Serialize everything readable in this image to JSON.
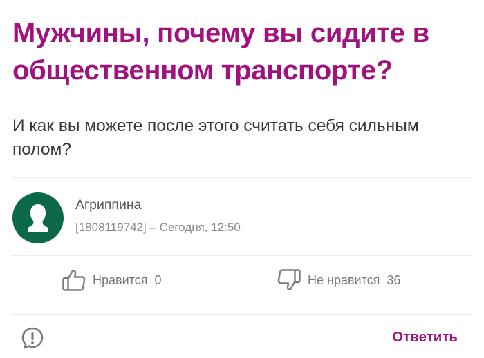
{
  "question": {
    "title": "Мужчины, почему вы сидите в общественном транспорте?",
    "body": "И как вы можете после этого считать себя сильным полом?"
  },
  "author": {
    "name": "Агриппина",
    "info": "[1808119742] – Сегодня, 12:50",
    "avatar_icon": "person-silhouette-icon",
    "avatar_color": "#0b6848"
  },
  "reactions": {
    "like_label": "Нравится",
    "like_count": "0",
    "dislike_label": "Не нравится",
    "dislike_count": "36"
  },
  "actions": {
    "report_icon": "exclamation-circle-icon",
    "reply_label": "Ответить"
  },
  "colors": {
    "accent": "#a2127f",
    "text": "#3a3a3a",
    "muted": "#8a8a8a"
  }
}
